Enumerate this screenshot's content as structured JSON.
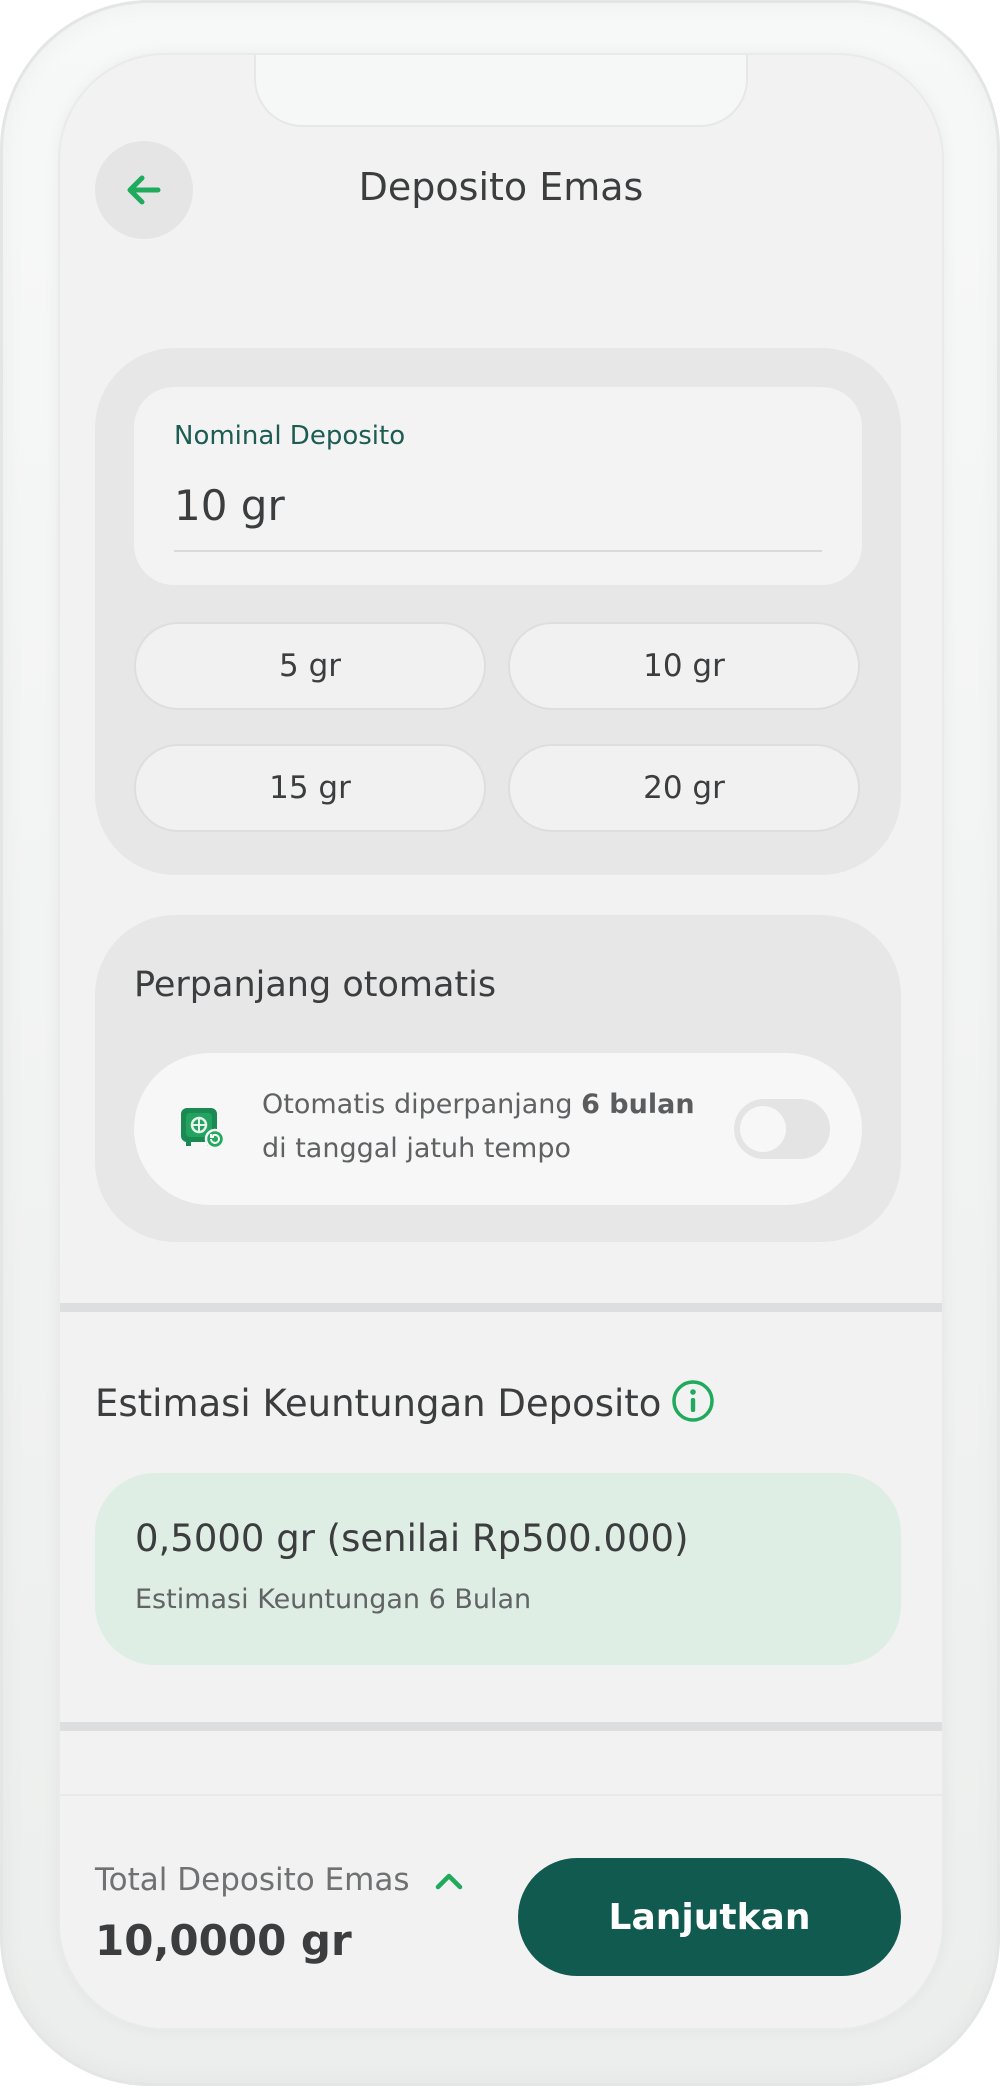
{
  "header": {
    "title": "Deposito Emas",
    "back_icon": "arrow-left-icon"
  },
  "nominal": {
    "label": "Nominal Deposito",
    "value": "10 gr",
    "options": [
      "5 gr",
      "10 gr",
      "15 gr",
      "20 gr"
    ]
  },
  "auto_renew": {
    "title": "Perpanjang otomatis",
    "text_prefix": "Otomatis diperpanjang ",
    "text_bold": "6 bulan",
    "text_line2": "di tanggal jatuh tempo",
    "icon": "safe-renew-icon",
    "enabled": false
  },
  "estimate": {
    "title": "Estimasi Keuntungan Deposito",
    "info_icon": "info-icon",
    "value": "0,5000 gr (senilai Rp500.000)",
    "subtitle": "Estimasi Keuntungan 6 Bulan"
  },
  "footer": {
    "total_label": "Total Deposito Emas",
    "total_value": "10,0000 gr",
    "expand_icon": "chevron-up-icon",
    "continue_label": "Lanjutkan"
  },
  "colors": {
    "accent_green": "#1faa5c",
    "primary_dark": "#105a50",
    "estimate_bg": "#dfeee5"
  }
}
